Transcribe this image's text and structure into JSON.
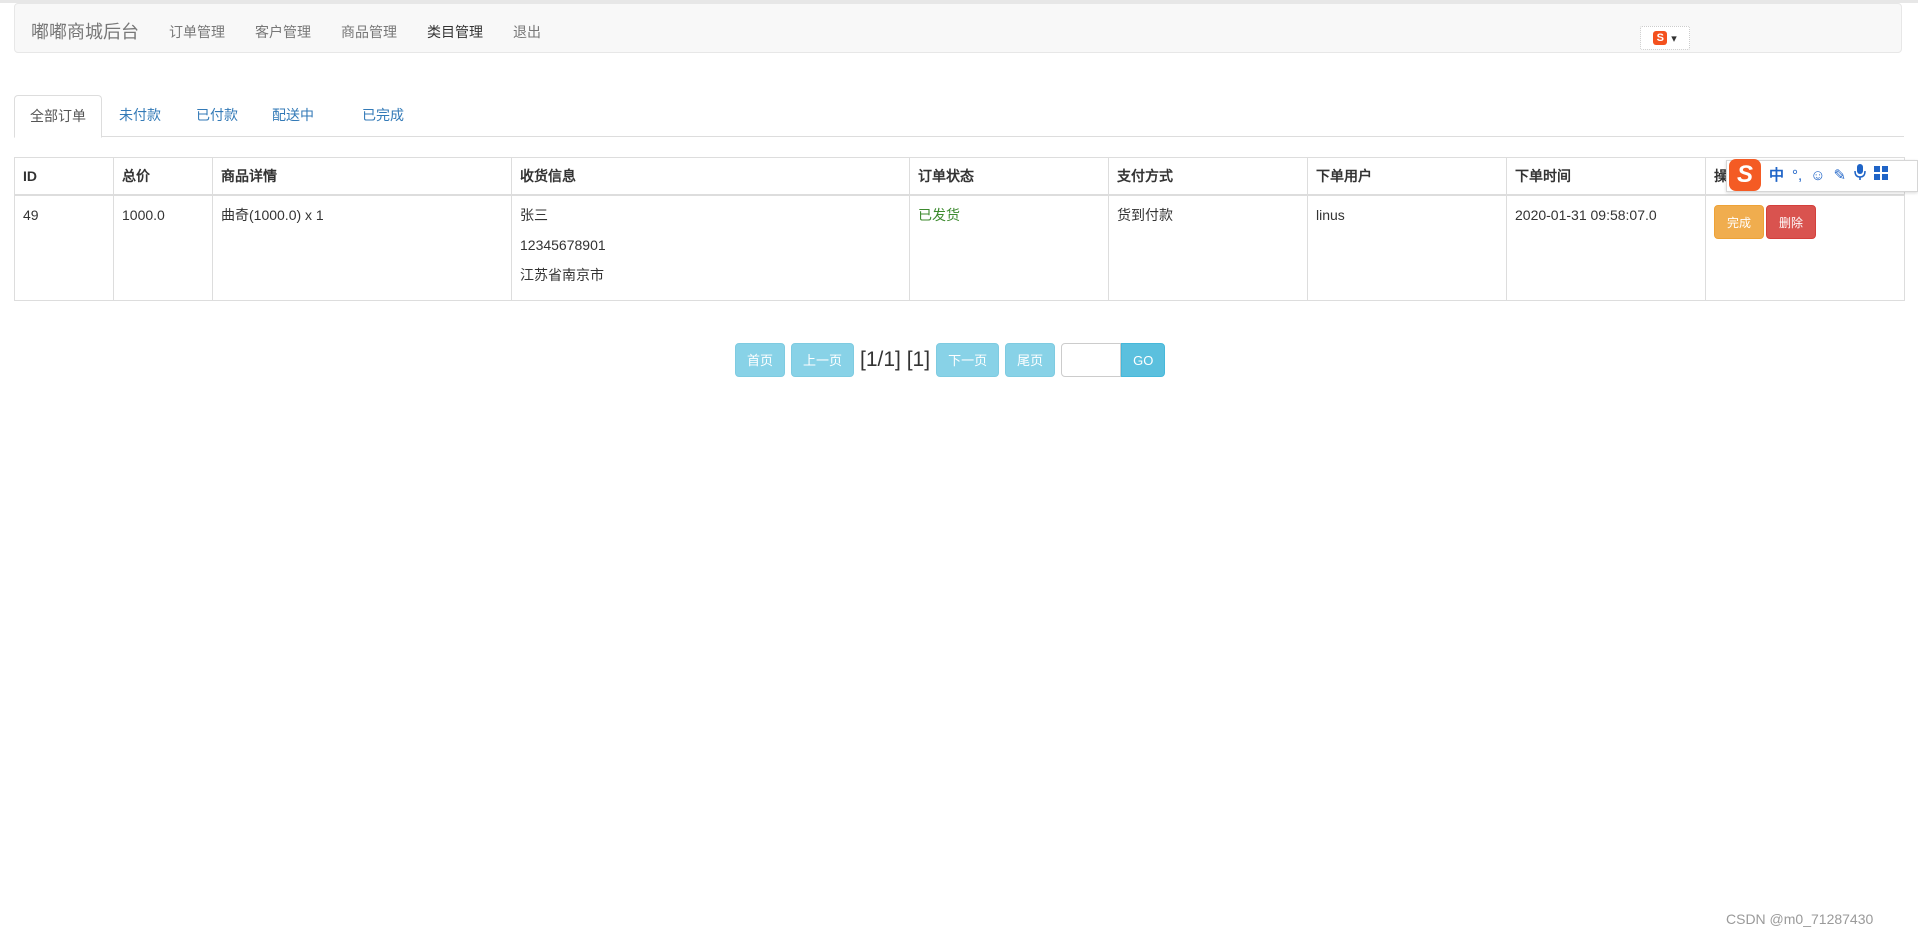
{
  "navbar": {
    "brand": "嘟嘟商城后台",
    "links": [
      "订单管理",
      "客户管理",
      "商品管理",
      "类目管理",
      "退出"
    ],
    "ime_mini_logo": "S"
  },
  "tabs": [
    "全部订单",
    "未付款",
    "已付款",
    "配送中",
    "已完成"
  ],
  "table": {
    "headers": [
      "ID",
      "总价",
      "商品详情",
      "收货信息",
      "订单状态",
      "支付方式",
      "下单用户",
      "下单时间",
      "操"
    ],
    "rows": [
      {
        "id": "49",
        "total": "1000.0",
        "items": "曲奇(1000.0) x 1",
        "receiver_name": "张三",
        "receiver_phone": "12345678901",
        "receiver_address": "江苏省南京市",
        "status": "已发货",
        "payment": "货到付款",
        "user": "linus",
        "time": "2020-01-31 09:58:07.0",
        "actions": {
          "complete": "完成",
          "delete": "删除"
        }
      }
    ]
  },
  "ime_toolbar": {
    "logo": "S",
    "mode": "中",
    "punct": "°,",
    "icons": [
      "smiley-icon",
      "pen-icon",
      "microphone-icon",
      "grid-icon"
    ]
  },
  "pagination": {
    "first": "首页",
    "prev": "上一页",
    "info": "[1/1] [1]",
    "next": "下一页",
    "last": "尾页",
    "input_value": "",
    "go": "GO"
  },
  "watermark": "CSDN @m0_71287430",
  "colors": {
    "link": "#337ab7",
    "shipped": "#3c8a2e",
    "warning": "#f0ad4e",
    "danger": "#d9534f",
    "info": "#5bc0de"
  }
}
